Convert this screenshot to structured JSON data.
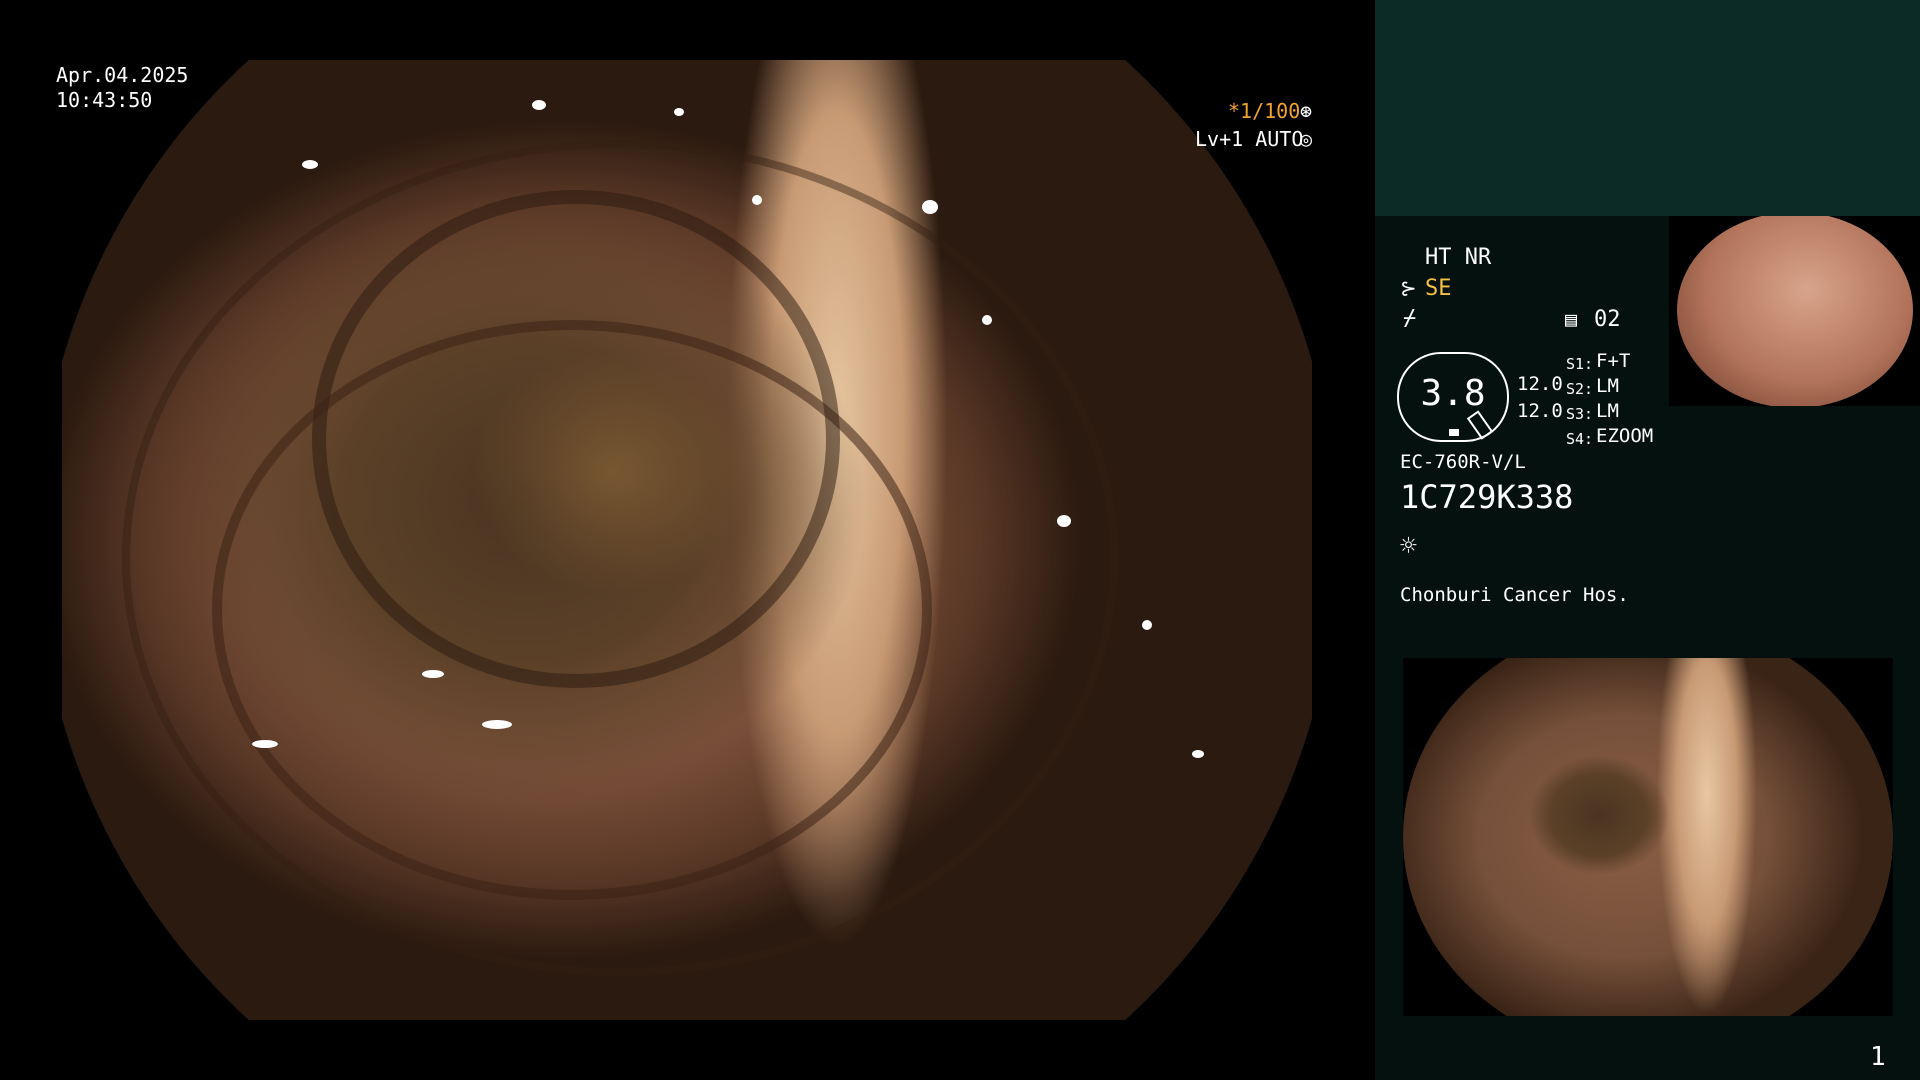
{
  "main": {
    "date": "Apr.04.2025",
    "time": "10:43:50",
    "shutter": "*1/100",
    "shutter_icon": "aperture-icon",
    "enhance": "Lv+1 AUTO",
    "enhance_icon": "auto-iris-icon"
  },
  "sidebar": {
    "ht_nr": "HT NR",
    "mode_icon": "structure-enhance-icon",
    "mode": "SE",
    "color_icon": "color-mode-icon",
    "memory_icon": "memory-card-icon",
    "memory": "02",
    "scope_value": "3.8",
    "values": [
      "12.0",
      "12.0"
    ],
    "switches": [
      {
        "key": "S1:",
        "val": "F+T"
      },
      {
        "key": "S2:",
        "val": "LM"
      },
      {
        "key": "S3:",
        "val": "LM"
      },
      {
        "key": "S4:",
        "val": "EZOOM"
      }
    ],
    "scope_model": "EC-760R-V/L",
    "serial": "1C729K338",
    "light_icon": "light-source-icon",
    "hospital": "Chonburi Cancer Hos.",
    "image_count": "1"
  },
  "colors": {
    "sidebar_bg": "#04110f",
    "sidebar_top_bg": "#0c2b27",
    "mode_color": "#f5c242",
    "shutter_color": "#f0a330"
  }
}
